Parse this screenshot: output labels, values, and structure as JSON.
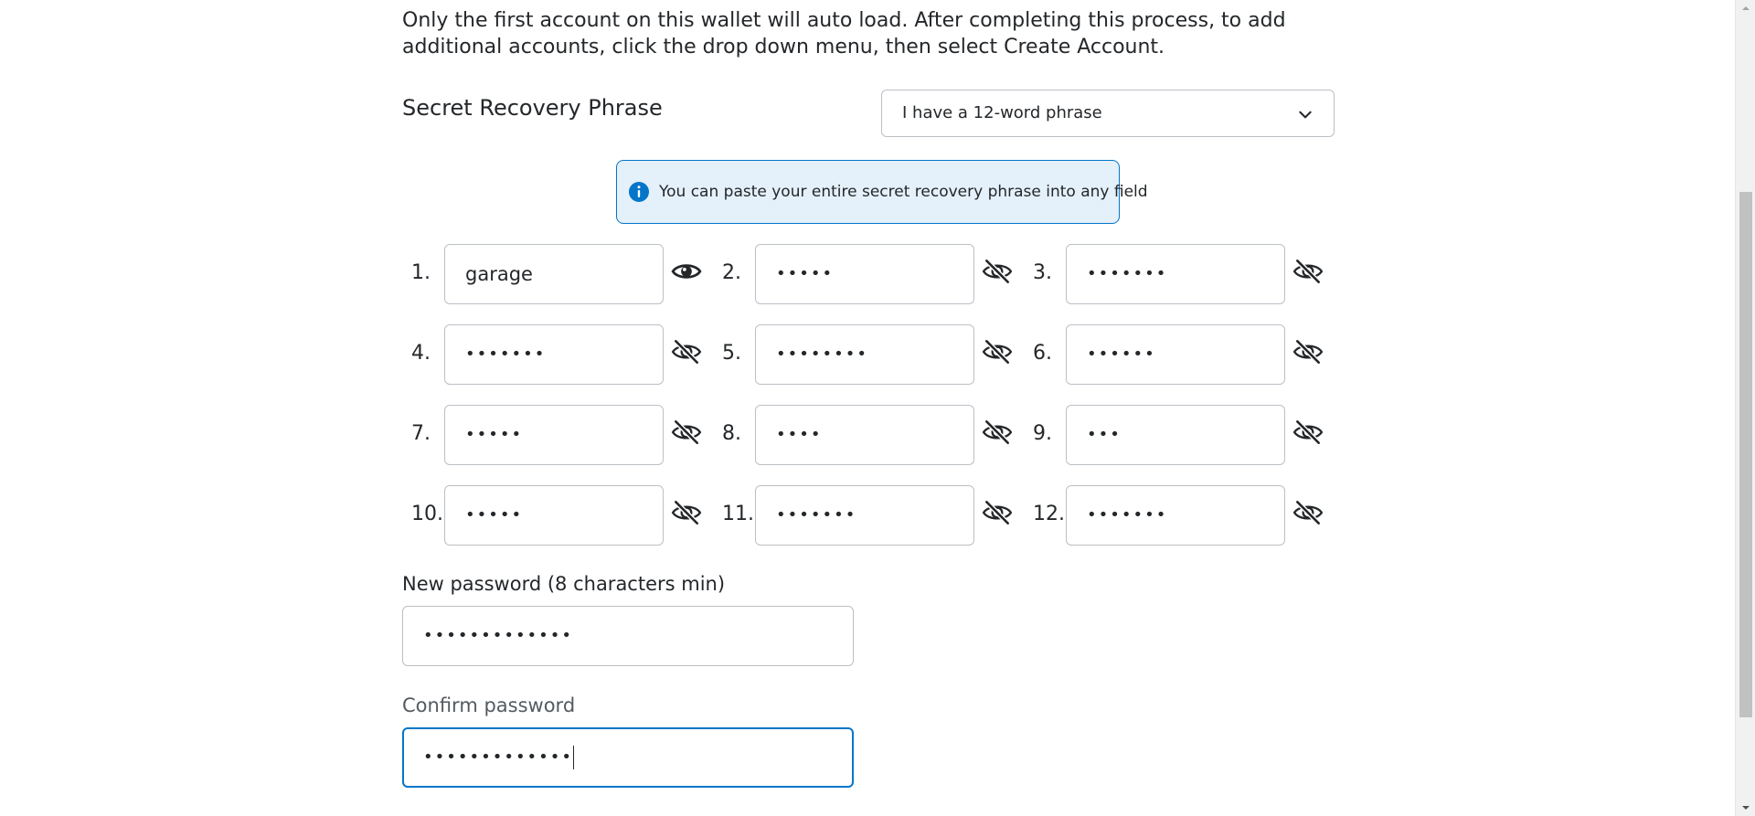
{
  "intro_text": "Only the first account on this wallet will auto load. After completing this process, to add additional accounts, click the drop down menu, then select Create Account.",
  "srp": {
    "label": "Secret Recovery Phrase",
    "select_value": "I have a 12-word phrase",
    "info_text": "You can paste your entire secret recovery phrase into any field"
  },
  "words": [
    {
      "num": "1.",
      "value": "garage",
      "visible": true
    },
    {
      "num": "2.",
      "value": "•••••",
      "visible": false
    },
    {
      "num": "3.",
      "value": "•••••••",
      "visible": false
    },
    {
      "num": "4.",
      "value": "•••••••",
      "visible": false
    },
    {
      "num": "5.",
      "value": "••••••••",
      "visible": false
    },
    {
      "num": "6.",
      "value": "••••••",
      "visible": false
    },
    {
      "num": "7.",
      "value": "•••••",
      "visible": false
    },
    {
      "num": "8.",
      "value": "••••",
      "visible": false
    },
    {
      "num": "9.",
      "value": "•••",
      "visible": false
    },
    {
      "num": "10.",
      "value": "•••••",
      "visible": false
    },
    {
      "num": "11.",
      "value": "•••••••",
      "visible": false
    },
    {
      "num": "12.",
      "value": "•••••••",
      "visible": false
    }
  ],
  "new_password": {
    "label": "New password (8 characters min)",
    "value": "•••••••••••••"
  },
  "confirm_password": {
    "label": "Confirm password",
    "value": "•••••••••••••"
  },
  "colors": {
    "accent": "#0376c9",
    "info_bg": "#e4f0fa",
    "border": "#bbc0c5",
    "text": "#24272a"
  },
  "icons": {
    "select": "chevron-down-icon",
    "info": "info-icon",
    "shown": "eye-icon",
    "hidden": "eye-slash-icon"
  }
}
